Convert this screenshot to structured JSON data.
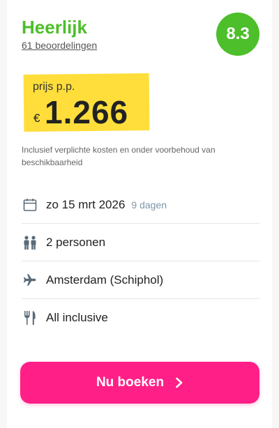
{
  "rating": {
    "title": "Heerlijk",
    "reviews_text": "61 beoordelingen",
    "score": "8.3"
  },
  "price": {
    "label": "prijs p.p.",
    "currency": "€",
    "amount": "1.266"
  },
  "disclaimer": "Inclusief verplichte kosten en onder voorbehoud van beschikbaarheid",
  "details": {
    "date": "zo 15 mrt 2026",
    "duration": "9 dagen",
    "persons": "2 personen",
    "departure": "Amsterdam (Schiphol)",
    "board": "All inclusive"
  },
  "icons": {
    "date": "calendar-icon",
    "persons": "persons-icon",
    "departure": "airplane-icon",
    "board": "fork-knife-icon",
    "book": "chevron-right-icon"
  },
  "book_button": {
    "label": "Nu boeken"
  },
  "colors": {
    "rating_green": "#4cbf2a",
    "price_highlight": "#ffde3b",
    "cta_pink": "#ff1f87",
    "subtle_blue": "#7c96a8"
  }
}
